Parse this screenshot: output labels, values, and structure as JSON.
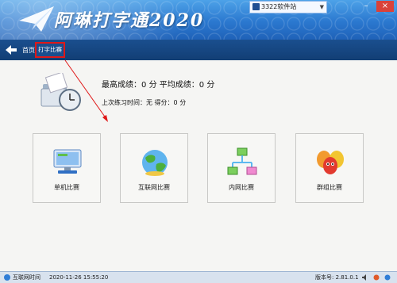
{
  "app": {
    "title": "阿琳打字通2020"
  },
  "user": {
    "label": "3322软件站"
  },
  "window": {
    "minimize": "–",
    "close": "×"
  },
  "breadcrumb": {
    "home": "首页",
    "separator": "›",
    "current": "打字比赛"
  },
  "stats": {
    "best_label": "最高成绩：",
    "best_value": "0",
    "best_unit": "分",
    "avg_label": "平均成绩：",
    "avg_value": "0",
    "avg_unit": "分",
    "last_time_label": "上次练习时间：",
    "last_time_value": "无",
    "score_label": "得分：",
    "score_value": "0",
    "score_unit": "分"
  },
  "modes": [
    {
      "label": "单机比赛",
      "icon": "computer-icon"
    },
    {
      "label": "互联网比赛",
      "icon": "globe-icon"
    },
    {
      "label": "内网比赛",
      "icon": "network-icon"
    },
    {
      "label": "群组比赛",
      "icon": "group-icon"
    }
  ],
  "statusbar": {
    "network": "互联网时间",
    "datetime": "2020-11-26 15:55:20",
    "version": "版本号: 2.81.0.1"
  },
  "colors": {
    "header": "#2b78cf",
    "navbar": "#1a4f8f",
    "highlight": "#e01818"
  }
}
